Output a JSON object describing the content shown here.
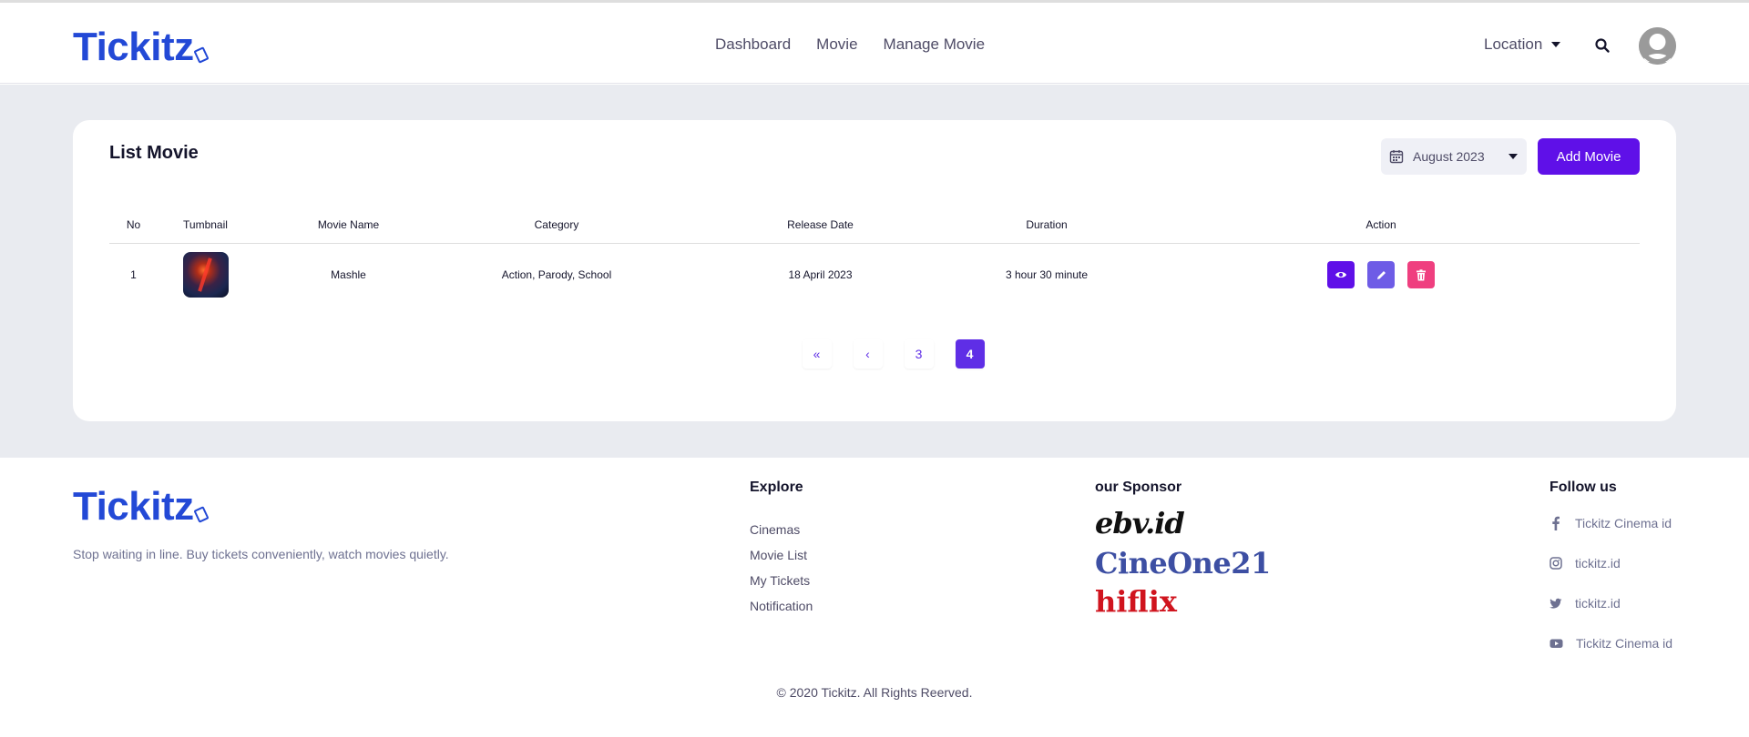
{
  "brand": {
    "name": "Tickitz"
  },
  "nav": {
    "items": [
      "Dashboard",
      "Movie",
      "Manage Movie"
    ]
  },
  "header": {
    "location_label": "Location"
  },
  "list": {
    "title": "List Movie",
    "month_filter": "August 2023",
    "add_label": "Add Movie",
    "columns": [
      "No",
      "Tumbnail",
      "Movie Name",
      "Category",
      "Release Date",
      "Duration",
      "Action"
    ],
    "rows": [
      {
        "no": "1",
        "name": "Mashle",
        "category": "Action, Parody, School",
        "release": "18 April 2023",
        "duration": "3 hour 30 minute"
      }
    ]
  },
  "pagination": {
    "first": "«",
    "prev": "‹",
    "pages": [
      "3",
      "4"
    ],
    "active": "4"
  },
  "footer": {
    "tagline": "Stop waiting in line. Buy tickets conveniently, watch movies quietly.",
    "explore": {
      "title": "Explore",
      "items": [
        "Cinemas",
        "Movie List",
        "My Tickets",
        "Notification"
      ]
    },
    "sponsor": {
      "title": "our Sponsor",
      "items": [
        "ebv.id",
        "CineOne21",
        "hiflix"
      ]
    },
    "follow": {
      "title": "Follow us",
      "items": [
        {
          "icon": "facebook-icon",
          "label": "Tickitz Cinema id"
        },
        {
          "icon": "instagram-icon",
          "label": "tickitz.id"
        },
        {
          "icon": "twitter-icon",
          "label": "tickitz.id"
        },
        {
          "icon": "youtube-icon",
          "label": "Tickitz Cinema id"
        }
      ]
    },
    "copyright": "© 2020 Tickitz. All Rights Reerved."
  },
  "colors": {
    "brand": "#2349d6",
    "primary": "#5f10e8",
    "edit": "#6e5ce6",
    "delete": "#ef3f7f",
    "background": "#e9ebf0"
  }
}
